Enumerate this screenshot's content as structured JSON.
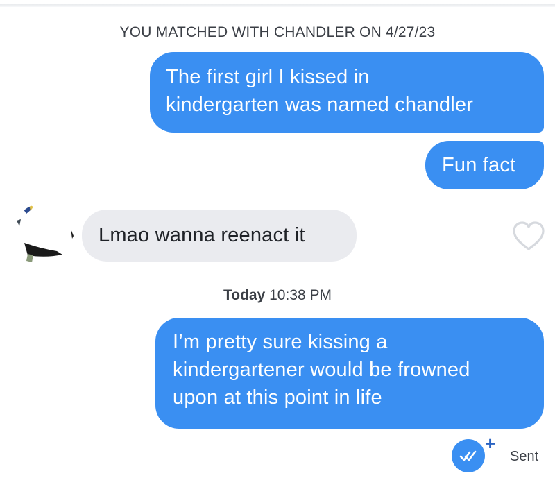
{
  "header": {
    "match_text": "YOU MATCHED WITH CHANDLER ON 4/27/23"
  },
  "messages": [
    {
      "direction": "outgoing",
      "lines": [
        "The first girl I kissed in",
        "kindergarten was named chandler"
      ]
    },
    {
      "direction": "outgoing",
      "lines": [
        "Fun fact"
      ]
    },
    {
      "direction": "incoming",
      "lines": [
        "Lmao wanna reenact it"
      ]
    },
    {
      "direction": "outgoing",
      "lines": [
        "I’m pretty sure kissing a",
        "kindergartener would be frowned",
        "upon at this point in life"
      ]
    }
  ],
  "timestamp": {
    "day": "Today",
    "time": "10:38 PM"
  },
  "status": {
    "label": "Sent",
    "plus": "+"
  },
  "icons": {
    "like": "heart-outline-icon",
    "read_receipt": "double-check-icon",
    "boost": "plus-icon"
  },
  "colors": {
    "sent_bubble": "#3a8ff2",
    "received_bubble": "#eaebef",
    "text_muted": "#3b3f46"
  }
}
